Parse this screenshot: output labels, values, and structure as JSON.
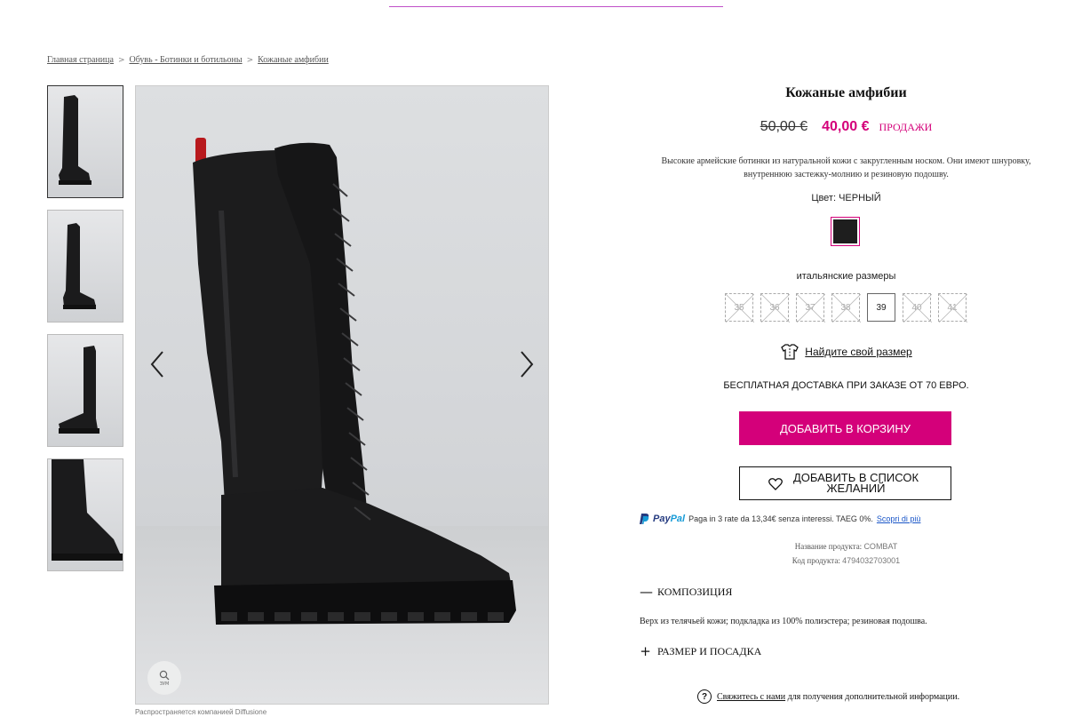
{
  "breadcrumb": {
    "items": [
      "Главная страница",
      "Обувь - Ботинки и ботильоны",
      "Кожаные амфибии"
    ]
  },
  "product": {
    "title": "Кожаные амфибии",
    "old_price": "50,00 €",
    "new_price": "40,00 €",
    "sale_label": "ПРОДАЖИ",
    "description": "Высокие армейские ботинки из натуральной кожи с закругленным носком. Они имеют шнуровку, внутреннюю застежку-молнию и резиновую подошву.",
    "color_label": "Цвет: ЧЕРНЫЙ",
    "swatch_color": "#1e1e1e",
    "sizes_label": "итальянские размеры",
    "sizes": [
      {
        "label": "35",
        "available": false
      },
      {
        "label": "36",
        "available": false
      },
      {
        "label": "37",
        "available": false
      },
      {
        "label": "38",
        "available": false
      },
      {
        "label": "39",
        "available": true
      },
      {
        "label": "40",
        "available": false
      },
      {
        "label": "41",
        "available": false
      }
    ],
    "find_size": "Найдите свой размер",
    "shipping": "БЕСПЛАТНАЯ ДОСТАВКА ПРИ ЗАКАЗЕ ОТ 70 ЕВРО.",
    "add_to_cart": "ДОБАВИТЬ В КОРЗИНУ",
    "add_to_wishlist": "ДОБАВИТЬ В СПИСОК ЖЕЛАНИЙ",
    "paypal": {
      "logo_pay": "Pay",
      "logo_pal": "Pal",
      "text": "Paga in 3 rate da 13,34€ senza interessi. TAEG 0%.",
      "link": "Scopri di più"
    },
    "name_label": "Название продукта:",
    "name_value": "COMBAT",
    "code_label": "Код продукта:",
    "code_value": "4794032703001",
    "composition_title": "КОМПОЗИЦИЯ",
    "composition_text": "Верх из телячьей кожи; подкладка из 100% полиэстера; резиновая подошва.",
    "size_fit_title": "РАЗМЕР И ПОСАДКА",
    "contact_link": "Свяжитесь с нами",
    "contact_text": "для получения дополнительной информации."
  },
  "gallery": {
    "zoom_label": "ЗУМ",
    "distributor": "Распространяется компанией Diffusione"
  },
  "colors": {
    "accent": "#d4007a",
    "paypal_dark": "#253b80",
    "paypal_light": "#179bd7",
    "boot": "#1b1b1c"
  },
  "icons": [
    "chevron-left-icon",
    "chevron-right-icon",
    "zoom-icon",
    "hanger-icon",
    "heart-icon",
    "question-icon",
    "minus-icon",
    "plus-icon"
  ]
}
